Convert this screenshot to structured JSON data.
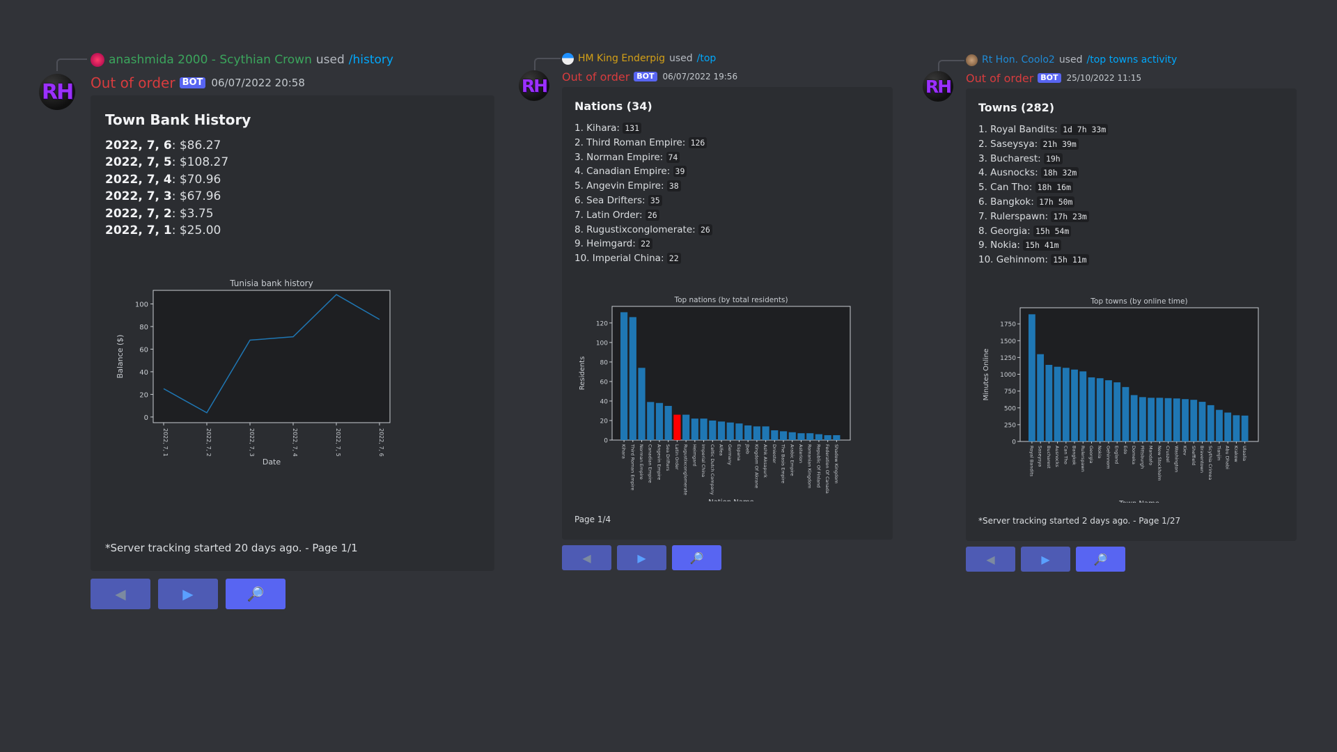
{
  "messages": [
    {
      "user": "anashmida 2000 - Scythian Crown",
      "user_color": "#3ba55c",
      "used": "used",
      "command": "/history",
      "bot_name": "Out of order",
      "badge": "BOT",
      "timestamp": "06/07/2022 20:58",
      "avatar_text": "RH",
      "embed_title": "Town Bank History",
      "lines": [
        {
          "bold": "2022, 7, 6",
          "text": ": $86.27"
        },
        {
          "bold": "2022, 7, 5",
          "text": ": $108.27"
        },
        {
          "bold": "2022, 7, 4",
          "text": ": $70.96"
        },
        {
          "bold": "2022, 7, 3",
          "text": ": $67.96"
        },
        {
          "bold": "2022, 7, 2",
          "text": ": $3.75"
        },
        {
          "bold": "2022, 7, 1",
          "text": ": $25.00"
        }
      ],
      "footer": "*Server tracking started 20 days ago. - Page 1/1",
      "buttons": [
        {
          "name": "previous-button",
          "glyph": "◀"
        },
        {
          "name": "next-button",
          "glyph": "▶"
        },
        {
          "name": "search-button",
          "glyph": "🔎"
        }
      ]
    },
    {
      "user": "HM King Enderpig",
      "user_color": "#d4a017",
      "used": "used",
      "command": "/top",
      "bot_name": "Out of order",
      "badge": "BOT",
      "timestamp": "06/07/2022 19:56",
      "avatar_text": "RH",
      "embed_title": "Nations (34)",
      "lines": [
        {
          "text": "1. Kihara:",
          "code": "131"
        },
        {
          "text": "2. Third Roman Empire:",
          "code": "126"
        },
        {
          "text": "3. Norman Empire:",
          "code": "74"
        },
        {
          "text": "4. Canadian Empire:",
          "code": "39"
        },
        {
          "text": "5. Angevin Empire:",
          "code": "38"
        },
        {
          "text": "6. Sea Drifters:",
          "code": "35"
        },
        {
          "text": "7. Latin Order:",
          "code": "26"
        },
        {
          "text": "8. Rugustixconglomerate:",
          "code": "26"
        },
        {
          "text": "9. Heimgard:",
          "code": "22"
        },
        {
          "text": "10. Imperial China:",
          "code": "22"
        }
      ],
      "footer": "Page 1/4",
      "buttons": [
        {
          "name": "previous-button",
          "glyph": "◀"
        },
        {
          "name": "next-button",
          "glyph": "▶"
        },
        {
          "name": "search-button",
          "glyph": "🔎"
        }
      ]
    },
    {
      "user": "Rt Hon. Coolo2",
      "user_color": "#1f8bd6",
      "used": "used",
      "command": "/top towns activity",
      "bot_name": "Out of order",
      "badge": "BOT",
      "timestamp": "25/10/2022 11:15",
      "avatar_text": "RH",
      "embed_title": "Towns (282)",
      "lines": [
        {
          "text": "1. Royal Bandits:",
          "code": "1d 7h 33m"
        },
        {
          "text": "2. Saseysya:",
          "code": "21h 39m"
        },
        {
          "text": "3. Bucharest:",
          "code": "19h"
        },
        {
          "text": "4. Ausnocks:",
          "code": "18h 32m"
        },
        {
          "text": "5. Can Tho:",
          "code": "18h 16m"
        },
        {
          "text": "6. Bangkok:",
          "code": "17h 50m"
        },
        {
          "text": "7. Rulerspawn:",
          "code": "17h 23m"
        },
        {
          "text": "8. Georgia:",
          "code": "15h 54m"
        },
        {
          "text": "9. Nokia:",
          "code": "15h 41m"
        },
        {
          "text": "10. Gehinnom:",
          "code": "15h 11m"
        }
      ],
      "footer": "*Server tracking started 2 days ago. - Page 1/27",
      "buttons": [
        {
          "name": "previous-button",
          "glyph": "◀"
        },
        {
          "name": "next-button",
          "glyph": "▶"
        },
        {
          "name": "search-button",
          "glyph": "🔎"
        }
      ]
    }
  ],
  "chart_data": [
    {
      "type": "line",
      "title": "Tunisia bank history",
      "xlabel": "Date",
      "ylabel": "Balance ($)",
      "x": [
        "2022, 7, 1",
        "2022, 7, 2",
        "2022, 7, 3",
        "2022, 7, 4",
        "2022, 7, 5",
        "2022, 7, 6"
      ],
      "y": [
        25.0,
        3.75,
        67.96,
        70.96,
        108.27,
        86.27
      ],
      "ylim": [
        -5,
        112
      ],
      "yticks": [
        0,
        20,
        40,
        60,
        80,
        100
      ],
      "line_color": "#1f77b4"
    },
    {
      "type": "bar",
      "title": "Top nations (by total residents)",
      "xlabel": "Nation Name",
      "ylabel": "Residents",
      "categories": [
        "Kihara",
        "Third Roman Empire",
        "Norman Empire",
        "Canadian Empire",
        "Angevin Empire",
        "Sea Drifters",
        "Latin Order",
        "Rugustixconglomerate",
        "Heimgard",
        "Imperial China",
        "Celtic Dutch Company",
        "Alfea",
        "Germany",
        "Espana",
        "Jbeb",
        "Kingdom Of Akrane",
        "Ashk Aksapurk",
        "Dniester",
        "The Basis Empire",
        "Arabic Empire",
        "Asterion",
        "Romanian Kingdom",
        "Republic Of Finland",
        "Federation Of Canada",
        "Shadow Kingdom"
      ],
      "values": [
        131,
        126,
        74,
        39,
        38,
        35,
        26,
        26,
        22,
        22,
        20,
        19,
        18,
        17,
        15,
        14,
        14,
        10,
        9,
        8,
        7,
        7,
        6,
        5,
        5
      ],
      "highlight_index": 6,
      "bar_color": "#1f77b4",
      "highlight_color": "#ff0000",
      "ylim": [
        0,
        137
      ],
      "yticks": [
        0,
        20,
        40,
        60,
        80,
        100,
        120
      ]
    },
    {
      "type": "bar",
      "title": "Top towns (by online time)",
      "xlabel": "Town Name",
      "ylabel": "Minutes Online",
      "categories": [
        "Royal Bandits",
        "Saseysya",
        "Bucharest",
        "Ausnocks",
        "Can Tho",
        "Bangkok",
        "Rulerspawn",
        "Georgia",
        "Nokia",
        "Gehinnom",
        "England",
        "Edo",
        "Domeka",
        "Pittsburgh",
        "Mandafo",
        "New Stockholm",
        "Cruszel",
        "Washington",
        "Kiev",
        "Sheffield",
        "Braventown",
        "Scythia Crimea",
        "Tianjin",
        "Abu Dhabi",
        "Krakow",
        "Ulaalia"
      ],
      "values": [
        1893,
        1299,
        1140,
        1112,
        1096,
        1070,
        1043,
        954,
        941,
        911,
        880,
        810,
        690,
        660,
        650,
        650,
        645,
        640,
        630,
        620,
        590,
        540,
        470,
        430,
        390,
        385
      ],
      "bar_color": "#1f77b4",
      "ylim": [
        0,
        1990
      ],
      "yticks": [
        0,
        250,
        500,
        750,
        1000,
        1250,
        1500,
        1750
      ]
    }
  ]
}
